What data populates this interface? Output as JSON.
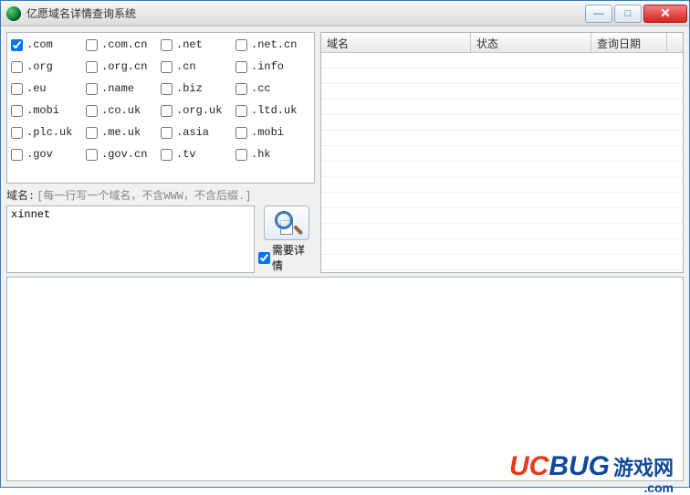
{
  "window": {
    "title": "亿愿域名详情查询系统"
  },
  "tlds": [
    {
      "label": ".com",
      "checked": true
    },
    {
      "label": ".com.cn",
      "checked": false
    },
    {
      "label": ".net",
      "checked": false
    },
    {
      "label": ".net.cn",
      "checked": false
    },
    {
      "label": ".org",
      "checked": false
    },
    {
      "label": ".org.cn",
      "checked": false
    },
    {
      "label": ".cn",
      "checked": false
    },
    {
      "label": ".info",
      "checked": false
    },
    {
      "label": ".eu",
      "checked": false
    },
    {
      "label": ".name",
      "checked": false
    },
    {
      "label": ".biz",
      "checked": false
    },
    {
      "label": ".cc",
      "checked": false
    },
    {
      "label": ".mobi",
      "checked": false
    },
    {
      "label": ".co.uk",
      "checked": false
    },
    {
      "label": ".org.uk",
      "checked": false
    },
    {
      "label": ".ltd.uk",
      "checked": false
    },
    {
      "label": ".plc.uk",
      "checked": false
    },
    {
      "label": ".me.uk",
      "checked": false
    },
    {
      "label": ".asia",
      "checked": false
    },
    {
      "label": ".mobi",
      "checked": false
    },
    {
      "label": ".gov",
      "checked": false
    },
    {
      "label": ".gov.cn",
      "checked": false
    },
    {
      "label": ".tv",
      "checked": false
    },
    {
      "label": ".hk",
      "checked": false
    }
  ],
  "domain_section": {
    "label": "域名:",
    "hint": "[每一行写一个域名，不含WWW，不含后缀.]",
    "value": "xinnet"
  },
  "need_detail": {
    "label": "需要详情",
    "checked": true
  },
  "table": {
    "columns": [
      "域名",
      "状态",
      "查询日期"
    ]
  },
  "watermark": {
    "brand1": "UC",
    "brand2": "BUG",
    "cn": "游戏网",
    "suffix": ".com"
  }
}
